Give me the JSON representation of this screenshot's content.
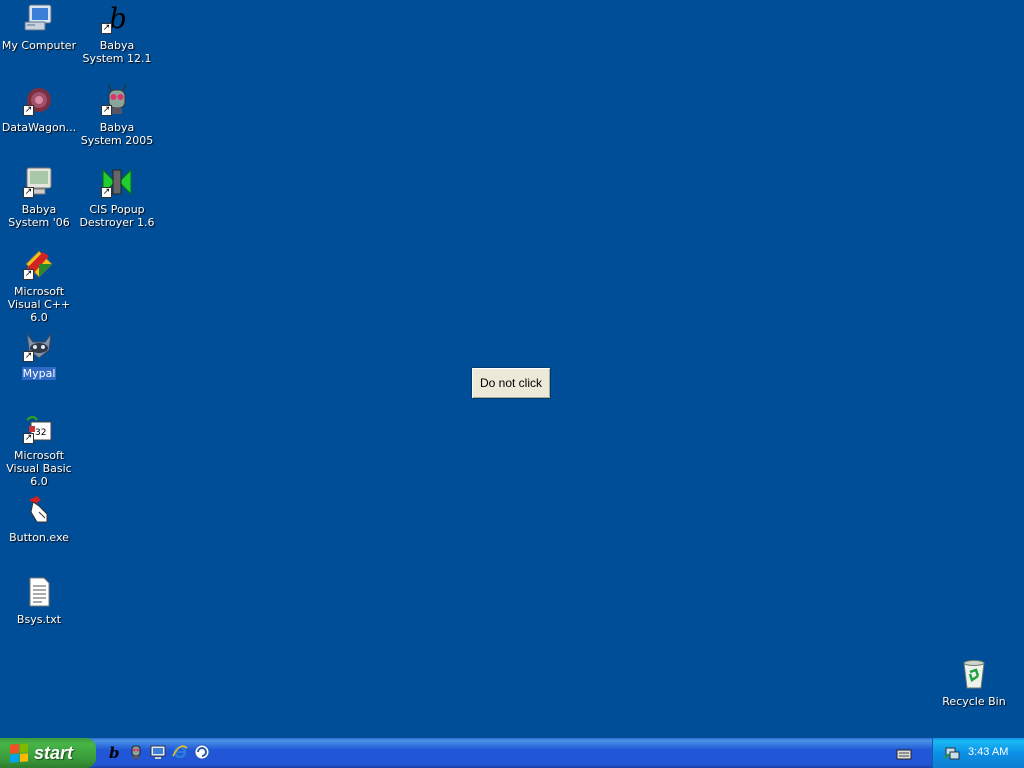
{
  "desktop": {
    "icons": [
      {
        "label": "My Computer"
      },
      {
        "label": "Babya System 12.1"
      },
      {
        "label": "DataWagon..."
      },
      {
        "label": "Babya System 2005"
      },
      {
        "label": "Babya System '06"
      },
      {
        "label": "CIS Popup Destroyer 1.6"
      },
      {
        "label": "Microsoft Visual C++ 6.0"
      },
      {
        "label": "Mypal"
      },
      {
        "label": "Microsoft Visual Basic 6.0"
      },
      {
        "label": "Button.exe"
      },
      {
        "label": "Bsys.txt"
      },
      {
        "label": "Recycle Bin"
      }
    ],
    "selected_icon": "Mypal"
  },
  "dialog": {
    "button_label": "Do not click"
  },
  "taskbar": {
    "start_label": "start",
    "quick_launch": [
      "babya-b-icon",
      "invader-icon",
      "show-desktop-icon",
      "internet-explorer-icon",
      "update-icon"
    ],
    "tray": {
      "time": "3:43 AM"
    }
  },
  "colors": {
    "desktop": "#004e98",
    "taskbar": "#2157d7",
    "start": "#3a9a3a",
    "tray": "#0c90e6",
    "selection": "#316ac5"
  }
}
